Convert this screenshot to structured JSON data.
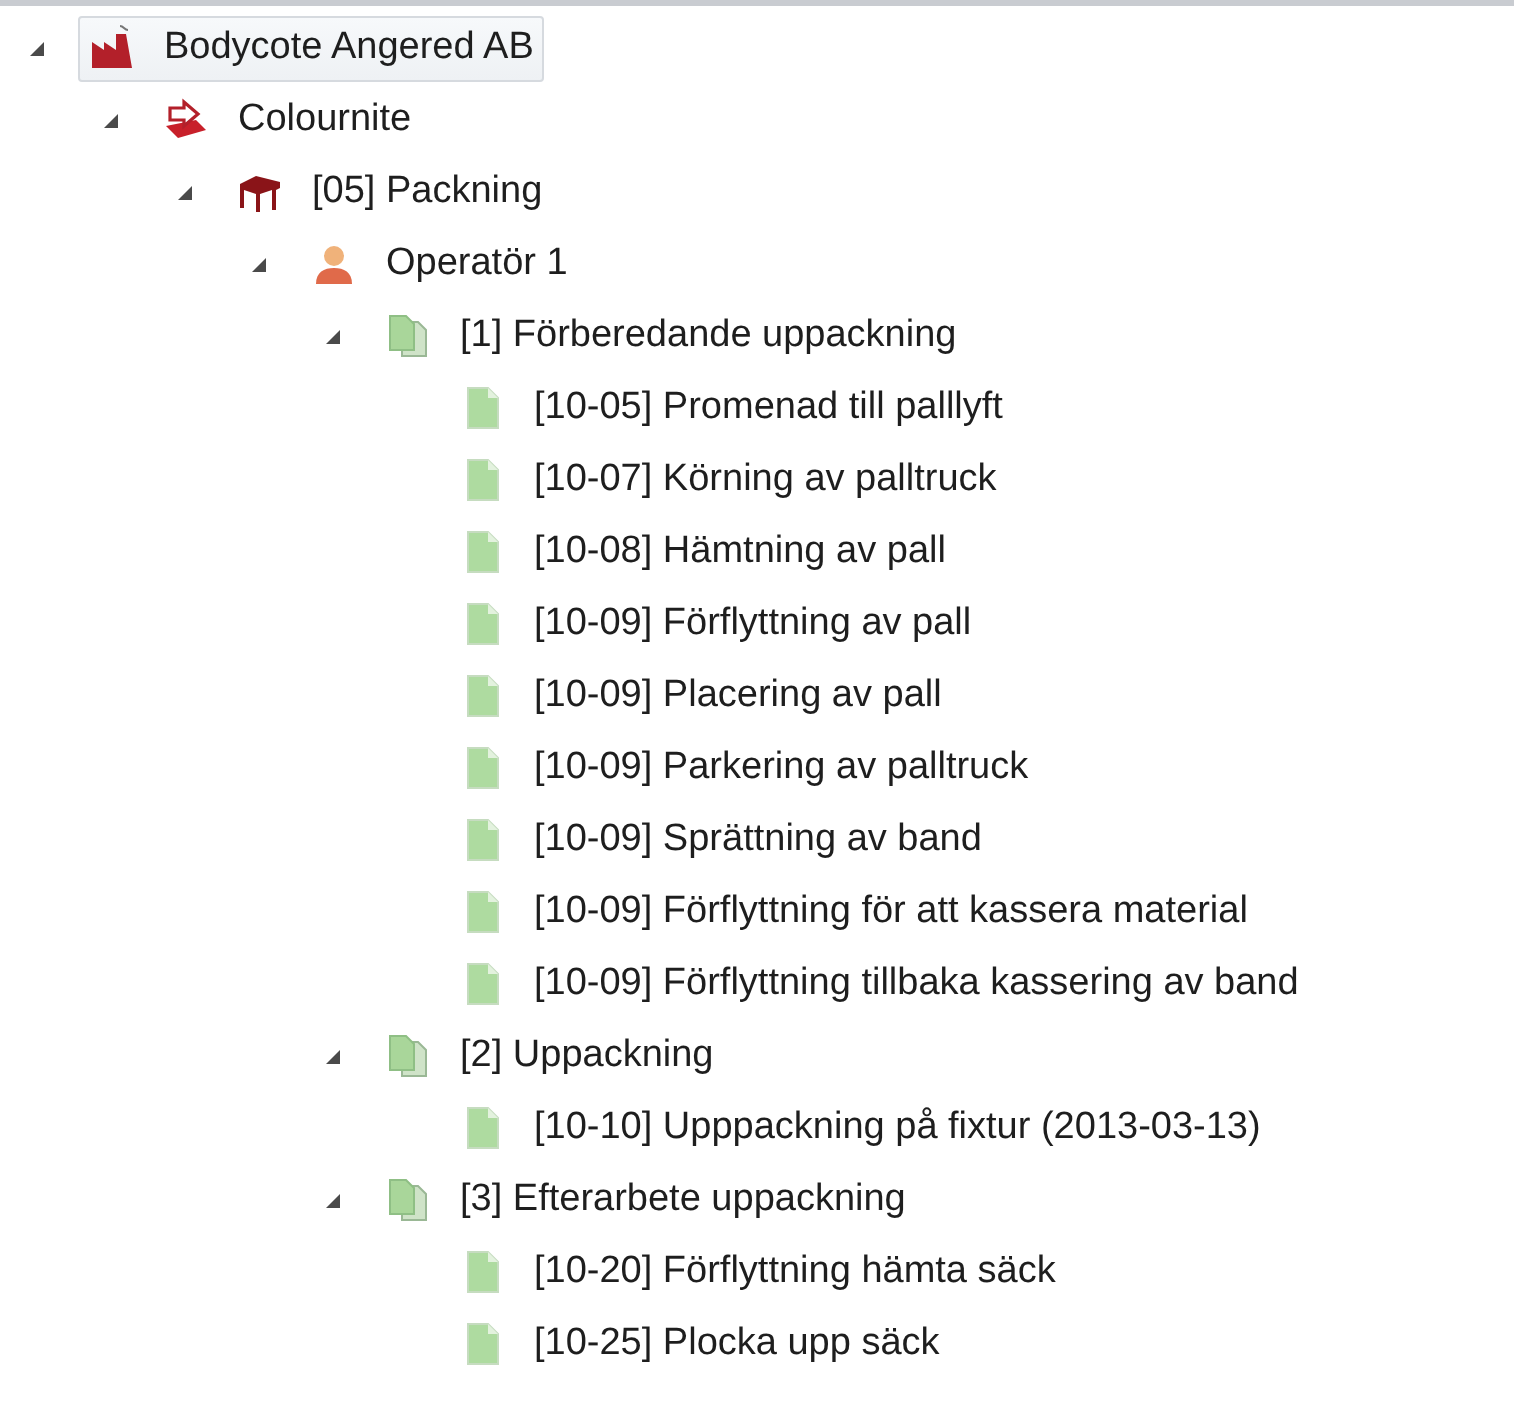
{
  "tree": [
    {
      "kind": "company",
      "label": "Bodycote Angered AB",
      "selected": true,
      "expanded": true,
      "children": [
        {
          "kind": "department",
          "label": "Colournite",
          "selected": false,
          "expanded": true,
          "children": [
            {
              "kind": "station",
              "label": "[05] Packning",
              "selected": false,
              "expanded": true,
              "children": [
                {
                  "kind": "operator",
                  "label": "Operatör 1",
                  "selected": false,
                  "expanded": true,
                  "children": [
                    {
                      "kind": "group",
                      "label": "[1] Förberedande uppackning",
                      "selected": false,
                      "expanded": true,
                      "children": [
                        {
                          "kind": "task",
                          "label": "[10-05] Promenad till palllyft",
                          "selected": false
                        },
                        {
                          "kind": "task",
                          "label": "[10-07] Körning av palltruck",
                          "selected": false
                        },
                        {
                          "kind": "task",
                          "label": "[10-08] Hämtning av pall",
                          "selected": false
                        },
                        {
                          "kind": "task",
                          "label": "[10-09] Förflyttning av pall",
                          "selected": false
                        },
                        {
                          "kind": "task",
                          "label": "[10-09] Placering av pall",
                          "selected": false
                        },
                        {
                          "kind": "task",
                          "label": "[10-09] Parkering av palltruck",
                          "selected": false
                        },
                        {
                          "kind": "task",
                          "label": "[10-09] Sprättning av band",
                          "selected": false
                        },
                        {
                          "kind": "task",
                          "label": "[10-09] Förflyttning för att kassera material",
                          "selected": false
                        },
                        {
                          "kind": "task",
                          "label": "[10-09] Förflyttning tillbaka kassering av band",
                          "selected": false
                        }
                      ]
                    },
                    {
                      "kind": "group",
                      "label": "[2] Uppackning",
                      "selected": false,
                      "expanded": true,
                      "children": [
                        {
                          "kind": "task",
                          "label": "[10-10] Upppackning på fixtur (2013-03-13)",
                          "selected": false
                        }
                      ]
                    },
                    {
                      "kind": "group",
                      "label": "[3] Efterarbete uppackning",
                      "selected": false,
                      "expanded": true,
                      "children": [
                        {
                          "kind": "task",
                          "label": "[10-20] Förflyttning hämta säck",
                          "selected": false
                        },
                        {
                          "kind": "task",
                          "label": "[10-25] Plocka upp säck",
                          "selected": false
                        }
                      ]
                    }
                  ]
                }
              ]
            }
          ]
        }
      ]
    }
  ]
}
